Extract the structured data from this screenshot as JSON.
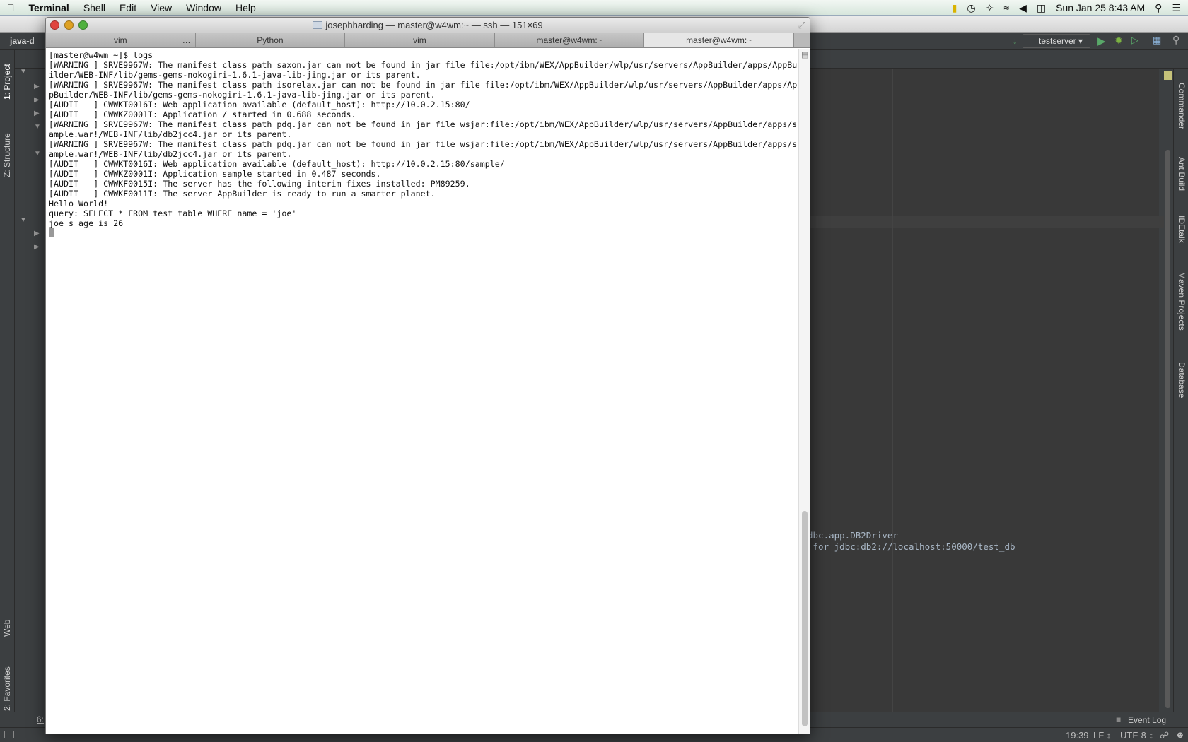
{
  "menubar": {
    "app": "Terminal",
    "items": [
      "Shell",
      "Edit",
      "View",
      "Window",
      "Help"
    ],
    "clock": "Sun Jan 25  8:43 AM"
  },
  "ide": {
    "project_label": "java-d",
    "run_config": "testserver",
    "left_tools": [
      "1: Project",
      "Z: Structure",
      "Web",
      "2: Favorites"
    ],
    "right_tools": [
      "Commander",
      "Ant Build",
      "IDEtalk",
      "Maven Projects",
      "Database"
    ],
    "editor_lines": [
      "dbc.app.DB2Driver",
      " for jdbc:db2://localhost:50000/test_db"
    ],
    "bottom_tool": "6:",
    "event_log": "Event Log",
    "status": {
      "position": "19:39",
      "line_sep": "LF ↕",
      "encoding": "UTF-8 ↕"
    }
  },
  "terminal": {
    "title": "josephharding — master@w4wm:~ — ssh — 151×69",
    "tabs": [
      {
        "label": "vim",
        "extra": "…"
      },
      {
        "label": "Python"
      },
      {
        "label": "vim"
      },
      {
        "label": "master@w4wm:~"
      },
      {
        "label": "master@w4wm:~",
        "active": true
      }
    ],
    "lines": [
      "[master@w4wm ~]$ logs",
      "[WARNING ] SRVE9967W: The manifest class path saxon.jar can not be found in jar file file:/opt/ibm/WEX/AppBuilder/wlp/usr/servers/AppBuilder/apps/AppBu",
      "ilder/WEB-INF/lib/gems-gems-nokogiri-1.6.1-java-lib-jing.jar or its parent.",
      "[WARNING ] SRVE9967W: The manifest class path isorelax.jar can not be found in jar file file:/opt/ibm/WEX/AppBuilder/wlp/usr/servers/AppBuilder/apps/Ap",
      "pBuilder/WEB-INF/lib/gems-gems-nokogiri-1.6.1-java-lib-jing.jar or its parent.",
      "[AUDIT   ] CWWKT0016I: Web application available (default_host): http://10.0.2.15:80/",
      "[AUDIT   ] CWWKZ0001I: Application / started in 0.688 seconds.",
      "[WARNING ] SRVE9967W: The manifest class path pdq.jar can not be found in jar file wsjar:file:/opt/ibm/WEX/AppBuilder/wlp/usr/servers/AppBuilder/apps/s",
      "ample.war!/WEB-INF/lib/db2jcc4.jar or its parent.",
      "[WARNING ] SRVE9967W: The manifest class path pdq.jar can not be found in jar file wsjar:file:/opt/ibm/WEX/AppBuilder/wlp/usr/servers/AppBuilder/apps/s",
      "ample.war!/WEB-INF/lib/db2jcc4.jar or its parent.",
      "[AUDIT   ] CWWKT0016I: Web application available (default_host): http://10.0.2.15:80/sample/",
      "[AUDIT   ] CWWKZ0001I: Application sample started in 0.487 seconds.",
      "[AUDIT   ] CWWKF0015I: The server has the following interim fixes installed: PM89259.",
      "[AUDIT   ] CWWKF0011I: The server AppBuilder is ready to run a smarter planet.",
      "Hello World!",
      "query: SELECT * FROM test_table WHERE name = 'joe'",
      "joe's age is 26"
    ]
  },
  "colors": {
    "close": "#e0443e",
    "minimize": "#dea123",
    "zoom": "#4fb13e",
    "run": "#59a869"
  }
}
